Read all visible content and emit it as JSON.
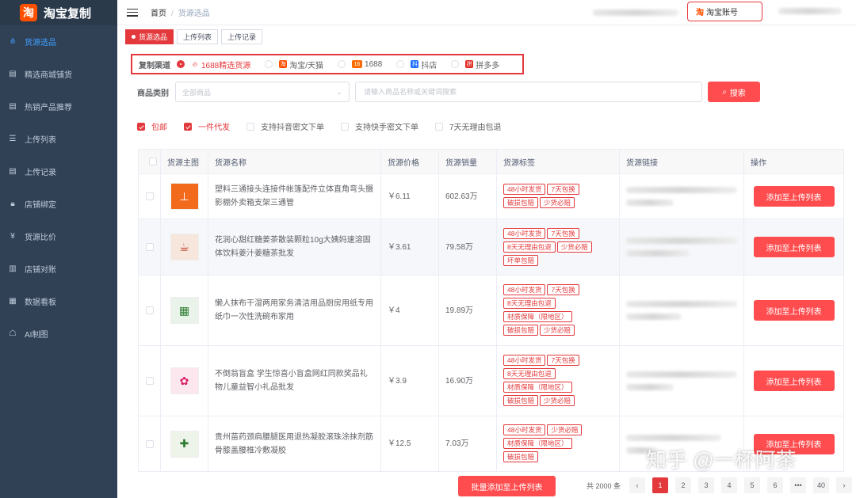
{
  "brand": {
    "logo_char": "淘",
    "name": "淘宝复制"
  },
  "sidebar": {
    "items": [
      {
        "label": "货源选品",
        "icon": "sitemap-icon"
      },
      {
        "label": "精选商城铺货",
        "icon": "document-icon"
      },
      {
        "label": "热销产品推荐",
        "icon": "document-icon"
      },
      {
        "label": "上传列表",
        "icon": "list-icon"
      },
      {
        "label": "上传记录",
        "icon": "document-icon"
      },
      {
        "label": "店铺绑定",
        "icon": "lock-icon"
      },
      {
        "label": "货源比价",
        "icon": "yen-icon"
      },
      {
        "label": "店铺对账",
        "icon": "book-icon"
      },
      {
        "label": "数据看板",
        "icon": "grid-icon"
      },
      {
        "label": "AI制图",
        "icon": "robot-icon"
      }
    ]
  },
  "breadcrumb": {
    "home": "首页",
    "separator": "/",
    "current": "货源选品"
  },
  "header": {
    "account_icon_char": "淘",
    "account_label": "淘宝账号"
  },
  "tabs": [
    {
      "label": "货源选品"
    },
    {
      "label": "上传列表"
    },
    {
      "label": "上传记录"
    }
  ],
  "filter": {
    "channel_label": "复制渠道",
    "channels": [
      {
        "label": "1688精选货源",
        "selected": true
      },
      {
        "label": "淘宝/天猫",
        "selected": false
      },
      {
        "label": "1688",
        "selected": false
      },
      {
        "label": "抖店",
        "selected": false
      },
      {
        "label": "拼多多",
        "selected": false
      }
    ],
    "category_label": "商品类别",
    "category_value": "全部商品",
    "keyword_placeholder": "请输入商品名称或关键词搜索",
    "search_label": "搜索",
    "checks": [
      {
        "label": "包邮",
        "checked": true
      },
      {
        "label": "一件代发",
        "checked": true
      },
      {
        "label": "支持抖音密文下单",
        "checked": false
      },
      {
        "label": "支持快手密文下单",
        "checked": false
      },
      {
        "label": "7天无理由包退",
        "checked": false
      }
    ]
  },
  "table": {
    "columns": [
      "货源主图",
      "货源名称",
      "货源价格",
      "货源销量",
      "货源标签",
      "货源链接",
      "操作"
    ],
    "rows": [
      {
        "name": "塑料三通接头连接件帐篷配件立体直角弯头摄影棚外卖箱支架三通管",
        "price": "￥6.11",
        "sales": "602.63万",
        "tags": [
          "48小时发货",
          "7天包换",
          "破损包赔",
          "少货必赔"
        ],
        "action": "添加至上传列表"
      },
      {
        "name": "花润心甜红糖姜茶散装颗粒10g大姨妈速溶固体饮料姜汁姜糖茶批发",
        "price": "￥3.61",
        "sales": "79.58万",
        "tags": [
          "48小时发货",
          "7天包换",
          "8天无理由包退",
          "少货必赔",
          "坏单包赔"
        ],
        "action": "添加至上传列表"
      },
      {
        "name": "懒人抹布干湿两用家务清洁用品厨房用纸专用纸巾一次性洗碗布家用",
        "price": "￥4",
        "sales": "19.89万",
        "tags": [
          "48小时发货",
          "7天包换",
          "8天无理由包退",
          "材质保障（限地区）",
          "破损包赔",
          "少货必赔"
        ],
        "action": "添加至上传列表"
      },
      {
        "name": "不倒翁盲盒 学生惊喜小盲盒网红同款奖品礼物儿童益智小礼品批发",
        "price": "￥3.9",
        "sales": "16.90万",
        "tags": [
          "48小时发货",
          "7天包换",
          "8天无理由包退",
          "材质保障（限地区）",
          "破损包赔",
          "少货必赔"
        ],
        "action": "添加至上传列表"
      },
      {
        "name": "贵州苗药颈肩腰腿医用退热凝胶滚珠涂抹剂筋骨膝盖腰椎冷敷凝胶",
        "price": "￥12.5",
        "sales": "7.03万",
        "tags": [
          "48小时发货",
          "少货必赔",
          "材质保障（限地区）",
          "破损包赔"
        ],
        "action": "添加至上传列表"
      }
    ]
  },
  "footer": {
    "bulk_label": "批量添加至上传列表",
    "total_text": "共 2000 条",
    "pages": [
      "1",
      "2",
      "3",
      "4",
      "5",
      "6",
      "•••",
      "40"
    ],
    "prev": "‹",
    "next": "›"
  },
  "watermark": "知乎 @一杯阿茶",
  "colors": {
    "accent": "#e4393c",
    "sidebar_bg": "#304156",
    "active_nav": "#409eff"
  }
}
